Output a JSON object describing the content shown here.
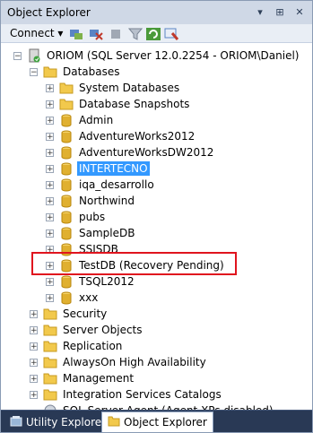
{
  "window": {
    "title": "Object Explorer",
    "title_buttons": [
      "▾",
      "⊞",
      "✕"
    ]
  },
  "toolbar": {
    "connect_label": "Connect ▾"
  },
  "tree": {
    "server": "ORIOM (SQL Server 12.0.2254 - ORIOM\\Daniel)",
    "databases_label": "Databases",
    "db_folders": [
      "System Databases",
      "Database Snapshots"
    ],
    "databases": [
      "Admin",
      "AdventureWorks2012",
      "AdventureWorksDW2012",
      "INTERTECNO",
      "iqa_desarrollo",
      "Northwind",
      "pubs",
      "SampleDB",
      "SSISDB",
      "TestDB (Recovery Pending)",
      "TSQL2012",
      "xxx"
    ],
    "server_folders": [
      "Security",
      "Server Objects",
      "Replication",
      "AlwaysOn High Availability",
      "Management",
      "Integration Services Catalogs"
    ],
    "agent_label": "SQL Server Agent (Agent XPs disabled)",
    "selected": "INTERTECNO"
  },
  "tabs": {
    "utility": "Utility Explorer",
    "object": "Object Explorer"
  },
  "colors": {
    "selection": "#3399ff",
    "highlight_border": "#e0141e",
    "folder": "#f2c94c",
    "database": "#e0b030"
  }
}
